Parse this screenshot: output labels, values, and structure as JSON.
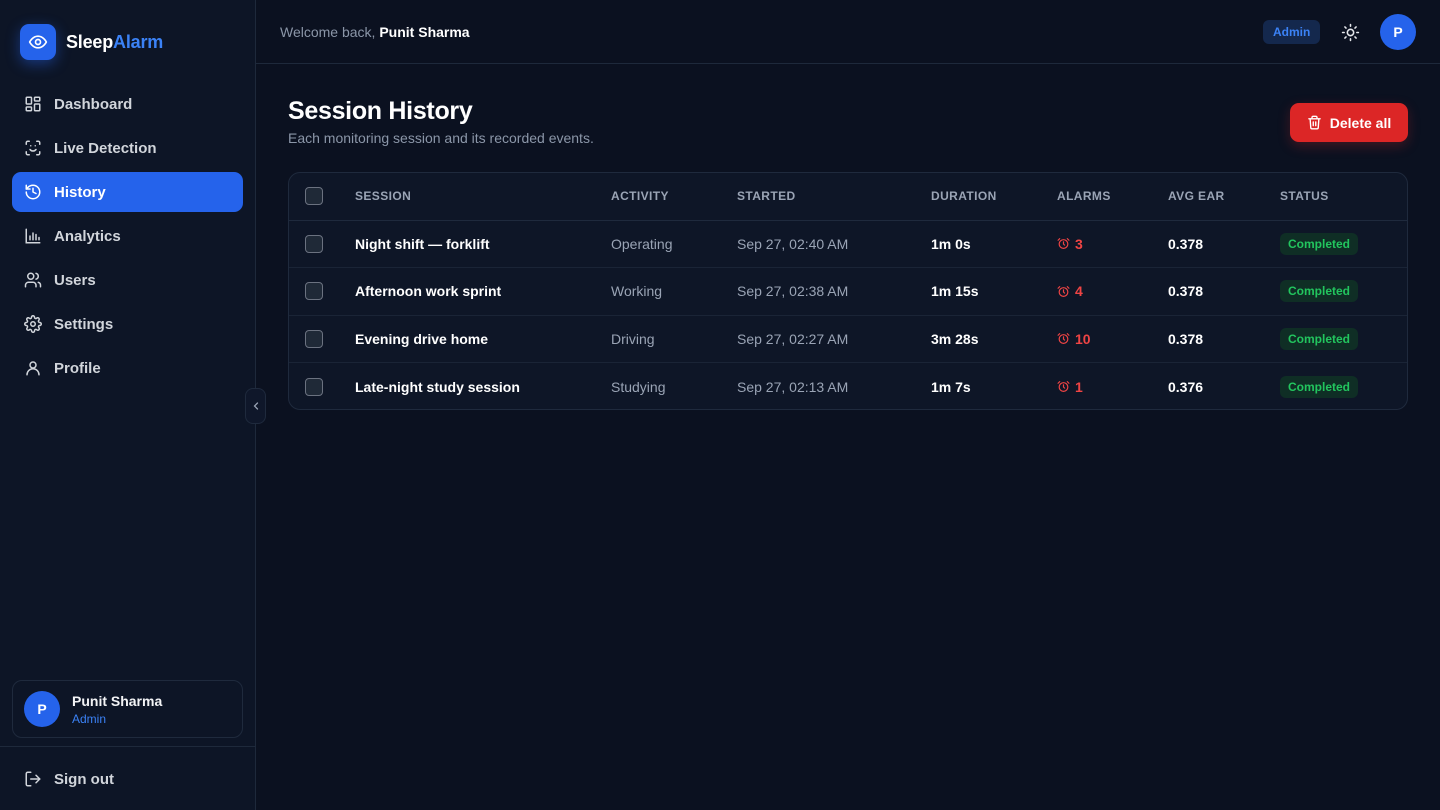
{
  "app": {
    "name_part1": "Sleep",
    "name_part2": "Alarm",
    "logo_icon": "eye-icon"
  },
  "sidebar": {
    "items": [
      {
        "label": "Dashboard",
        "icon": "dashboard-grid-icon",
        "active": false
      },
      {
        "label": "Live Detection",
        "icon": "face-scan-icon",
        "active": false
      },
      {
        "label": "History",
        "icon": "history-clock-icon",
        "active": true
      },
      {
        "label": "Analytics",
        "icon": "bar-chart-icon",
        "active": false
      },
      {
        "label": "Users",
        "icon": "users-icon",
        "active": false
      },
      {
        "label": "Settings",
        "icon": "gear-icon",
        "active": false
      },
      {
        "label": "Profile",
        "icon": "user-icon",
        "active": false
      }
    ],
    "user": {
      "initial": "P",
      "name": "Punit Sharma",
      "role": "Admin"
    },
    "signout_label": "Sign out"
  },
  "header": {
    "welcome_prefix": "Welcome back,",
    "welcome_name": "Punit Sharma",
    "role_badge": "Admin",
    "avatar_initial": "P"
  },
  "main": {
    "title": "Session History",
    "subtitle": "Each monitoring session and its recorded events.",
    "delete_all_label": "Delete all"
  },
  "table": {
    "columns": [
      "SESSION",
      "ACTIVITY",
      "STARTED",
      "DURATION",
      "ALARMS",
      "AVG EAR",
      "STATUS"
    ],
    "rows": [
      {
        "session": "Night shift — forklift",
        "activity": "Operating",
        "started": "Sep 27, 02:40 AM",
        "duration": "1m 0s",
        "alarms": "3",
        "avg_ear": "0.378",
        "status": "Completed"
      },
      {
        "session": "Afternoon work sprint",
        "activity": "Working",
        "started": "Sep 27, 02:38 AM",
        "duration": "1m 15s",
        "alarms": "4",
        "avg_ear": "0.378",
        "status": "Completed"
      },
      {
        "session": "Evening drive home",
        "activity": "Driving",
        "started": "Sep 27, 02:27 AM",
        "duration": "3m 28s",
        "alarms": "10",
        "avg_ear": "0.378",
        "status": "Completed"
      },
      {
        "session": "Late-night study session",
        "activity": "Studying",
        "started": "Sep 27, 02:13 AM",
        "duration": "1m 7s",
        "alarms": "1",
        "avg_ear": "0.376",
        "status": "Completed"
      }
    ]
  },
  "colors": {
    "accent": "#2563eb",
    "danger": "#dc2626",
    "success": "#22c55e",
    "background": "#0b1120"
  }
}
